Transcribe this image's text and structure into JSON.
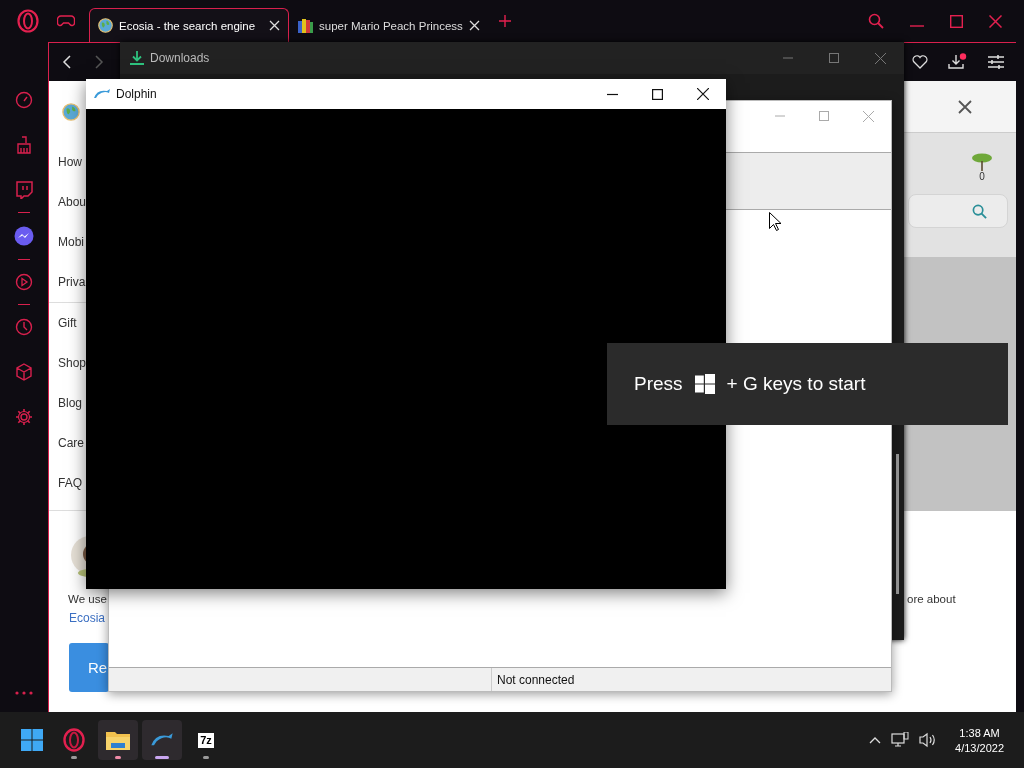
{
  "browser": {
    "tabs": [
      {
        "title": "Ecosia - the search engine",
        "selected": true
      },
      {
        "title": "super Mario Peach Princess",
        "selected": false
      }
    ]
  },
  "ecosia": {
    "menu_groups": [
      [
        "How",
        "Abou",
        "Mobi",
        "Priva"
      ],
      [
        "Gift",
        "Shop",
        "Blog",
        "Care",
        "FAQ"
      ]
    ],
    "tree_count": "0",
    "cookie": {
      "text_start": "We use",
      "text_end": "ore about",
      "link": "Ecosia",
      "button": "Re"
    }
  },
  "downloads_window": {
    "title": "Downloads"
  },
  "dolphin_main": {
    "status": "Not connected"
  },
  "dolphin_render": {
    "title": "Dolphin"
  },
  "game_bar_toast": {
    "before": "Press",
    "after": "+ G keys to start"
  },
  "taskbar": {
    "apps": [
      {
        "kind": "opera",
        "focused": false,
        "attention": false
      },
      {
        "kind": "folder",
        "focused": false,
        "attention": true
      },
      {
        "kind": "dolphin",
        "focused": true,
        "attention": false
      },
      {
        "kind": "archiver",
        "label": "7z",
        "focused": false,
        "attention": false
      }
    ],
    "time": "1:38 AM",
    "date": "4/13/2022"
  }
}
